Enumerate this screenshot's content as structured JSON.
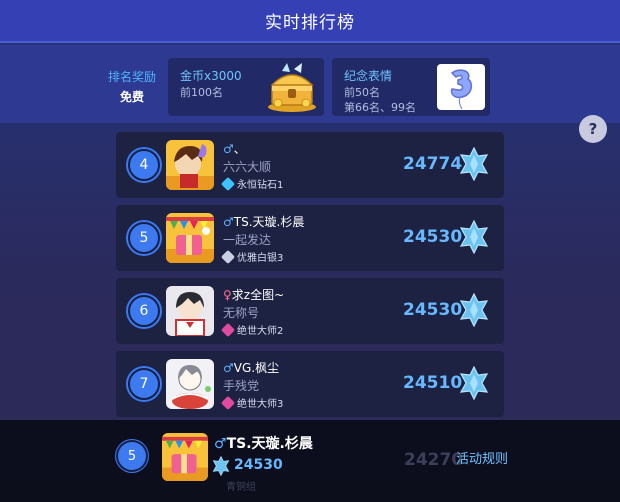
{
  "header": {
    "title": "实时排行榜"
  },
  "rewards": {
    "label_line1": "排名奖励",
    "label_line2": "免费",
    "gold_card": {
      "title": "金币x3000",
      "line1": "前100名"
    },
    "emoji_card": {
      "title": "纪念表情",
      "line1": "前50名",
      "line2": "第66名、99名"
    },
    "help_label": "?"
  },
  "rows": [
    {
      "rank": "4",
      "gender": "♂",
      "gender_type": "male",
      "name": "、",
      "motto": "六六大顺",
      "tier": "永恒钻石1",
      "tier_color": "#3ec3ff",
      "score": "24774"
    },
    {
      "rank": "5",
      "gender": "♂",
      "gender_type": "male",
      "name": "TS.天璇.杉晨",
      "motto": "一起发达",
      "tier": "优雅白银3",
      "tier_color": "#c9cfe0",
      "score": "24530"
    },
    {
      "rank": "6",
      "gender": "♀",
      "gender_type": "female",
      "name": "求z全图~",
      "motto": "无称号",
      "tier": "绝世大师2",
      "tier_color": "#e04aa0",
      "score": "24530"
    },
    {
      "rank": "7",
      "gender": "♂",
      "gender_type": "male",
      "name": "VG.枫尘",
      "motto": "手残党",
      "tier": "绝世大师3",
      "tier_color": "#e04aa0",
      "score": "24510"
    }
  ],
  "self": {
    "rank": "5",
    "gender": "♂",
    "name": "TS.天璇.杉晨",
    "score": "24530"
  },
  "ghost_row": {
    "score": "24270",
    "tier": "青铜组"
  },
  "footer": {
    "rules": "活动规则"
  },
  "colors": {
    "accent_blue": "#67b8ff",
    "header_bg": "#3440b4",
    "rank_badge": "#3d7af0"
  }
}
